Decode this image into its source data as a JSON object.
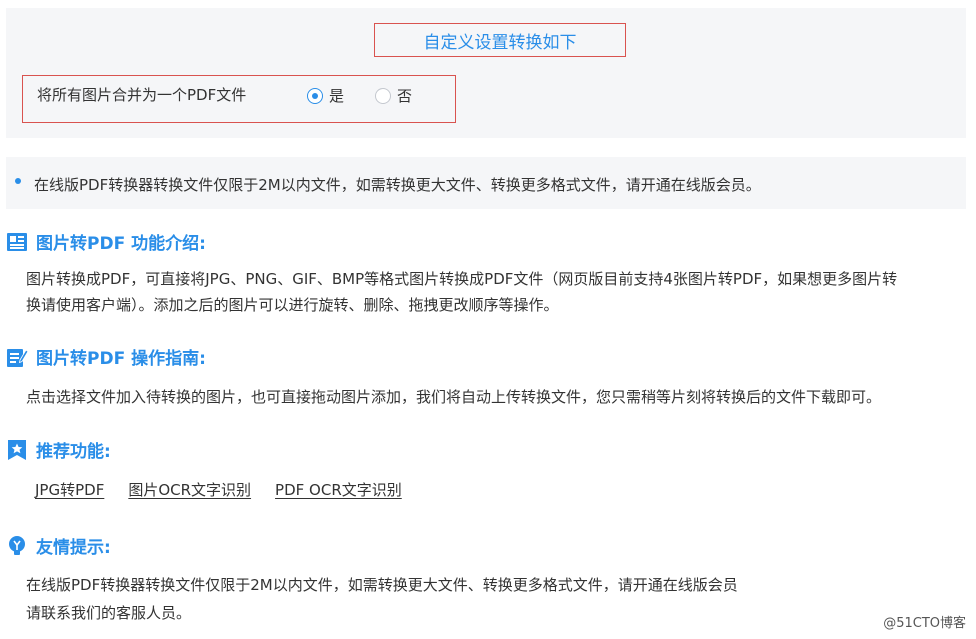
{
  "settings": {
    "title": "自定义设置转换如下",
    "merge_label": "将所有图片合并为一个PDF文件",
    "option_yes": "是",
    "option_no": "否",
    "selected": "yes"
  },
  "notice": {
    "text": "在线版PDF转换器转换文件仅限于2M以内文件，如需转换更大文件、转换更多格式文件，请开通在线版会员。"
  },
  "intro": {
    "title": "图片转PDF 功能介绍:",
    "line1": "图片转换成PDF，可直接将JPG、PNG、GIF、BMP等格式图片转换成PDF文件（网页版目前支持4张图片转PDF，如果想更多图片转",
    "line2": "换请使用客户端）。添加之后的图片可以进行旋转、删除、拖拽更改顺序等操作。"
  },
  "guide": {
    "title": "图片转PDF 操作指南:",
    "text": "点击选择文件加入待转换的图片，也可直接拖动图片添加，我们将自动上传转换文件，您只需稍等片刻将转换后的文件下载即可。"
  },
  "recommend": {
    "title": "推荐功能:",
    "links": [
      "JPG转PDF",
      "图片OCR文字识别",
      "PDF OCR文字识别"
    ]
  },
  "tips": {
    "title": "友情提示:",
    "line1": "在线版PDF转换器转换文件仅限于2M以内文件，如需转换更大文件、转换更多格式文件，请开通在线版会员",
    "line2": "请联系我们的客服人员。"
  },
  "watermark": "@51CTO博客",
  "colors": {
    "accent": "#2a8ee8",
    "highlight_border": "#d9534f",
    "panel_bg": "#f5f6f8"
  }
}
